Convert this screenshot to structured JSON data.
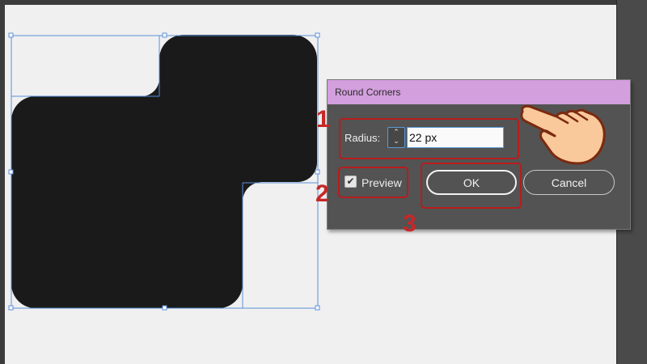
{
  "dialog": {
    "title": "Round Corners",
    "radius_label": "Radius:",
    "radius_value": "22 px",
    "preview_label": "Preview",
    "preview_checked": true,
    "ok_label": "OK",
    "cancel_label": "Cancel"
  },
  "annotations": {
    "step1": "1",
    "step2": "2",
    "step3": "3"
  },
  "icons": {
    "stepper": "up-down-arrows-icon",
    "checkbox": "checkmark-icon",
    "pointer": "pointing-hand-icon"
  },
  "colors": {
    "dialog_title_bar": "#d39fdd",
    "dialog_body": "#535353",
    "shape_fill": "#1a1a1a",
    "selection": "#5b8fd9",
    "annotation_red": "#c62828",
    "canvas_bg": "#f0f0f0"
  }
}
